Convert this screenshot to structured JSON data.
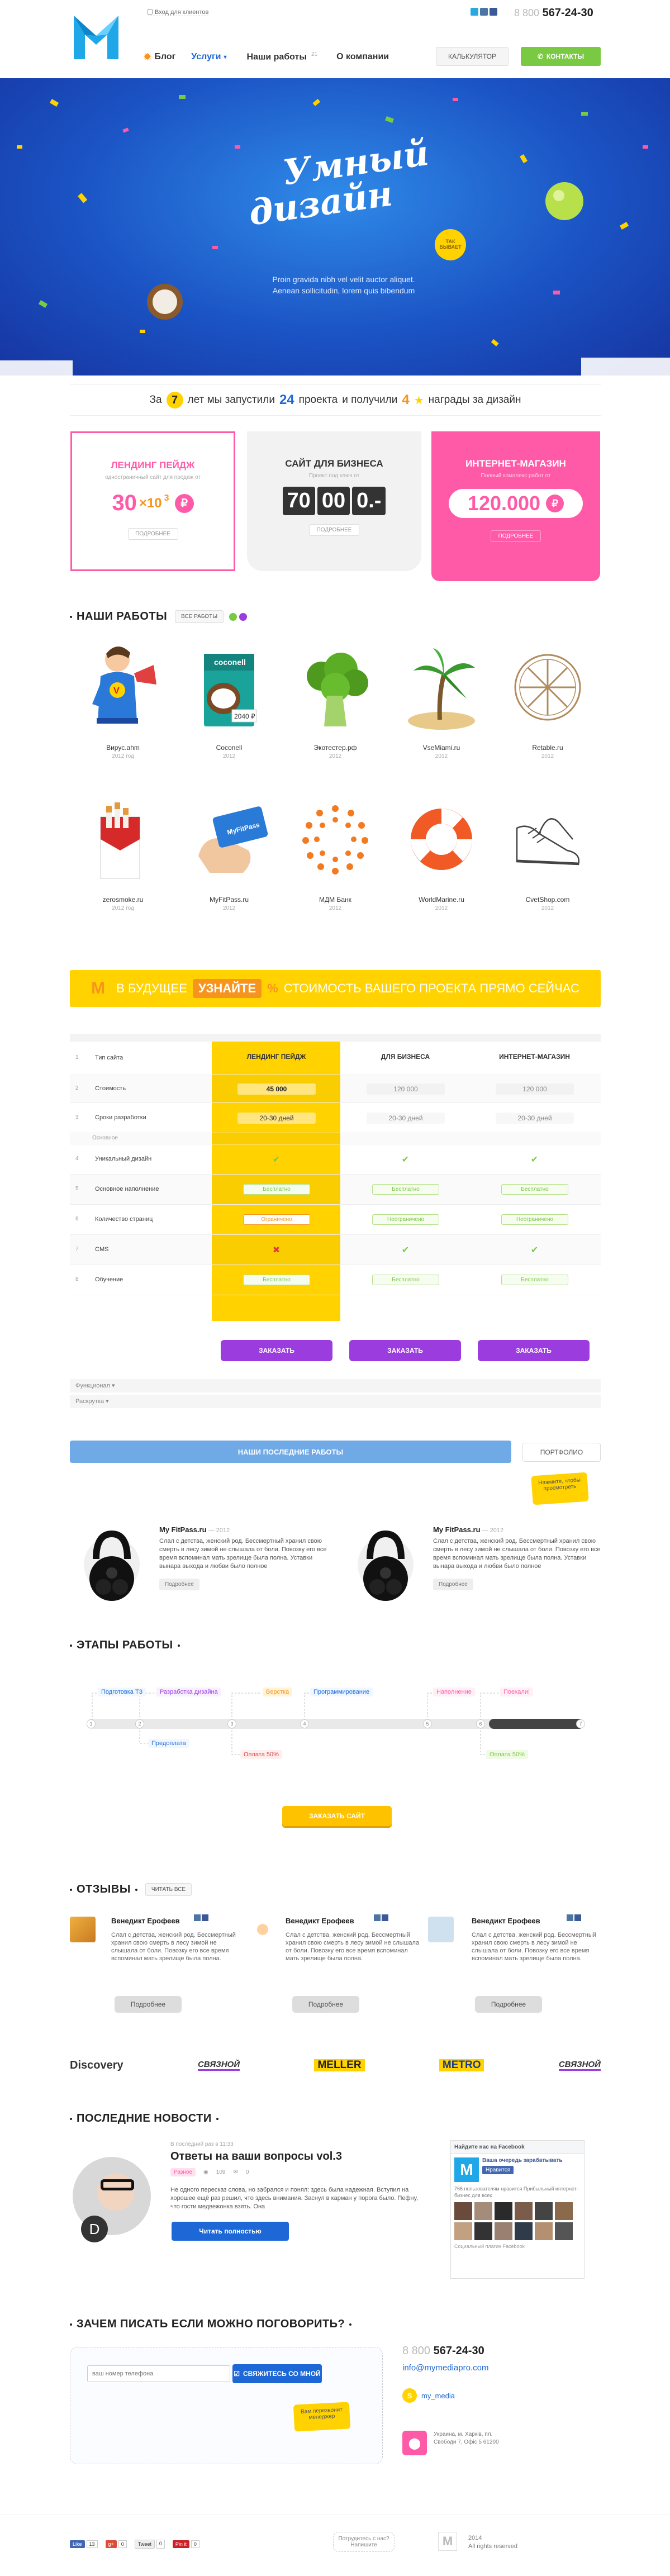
{
  "header": {
    "logo_letter": "M",
    "login_link": "Вход для клиентов",
    "phone_prefix": "8 800",
    "phone": "567-24-30",
    "nav": [
      {
        "label": "Блог"
      },
      {
        "label": "Услуги"
      },
      {
        "label": "Наши работы",
        "count": "21"
      },
      {
        "label": "О компании"
      }
    ],
    "calc_label": "Калькулятор",
    "contacts_label": "Контакты"
  },
  "hero": {
    "title_line1": "Умный",
    "title_line2": "дизайн",
    "badge": "Так бывает",
    "text": "Proin gravida nibh vel velit auctor aliquet. Aenean sollicitudin, lorem quis bibendum"
  },
  "stats": {
    "p1": "За",
    "years": "7",
    "p2": "лет мы запустили",
    "projects": "24",
    "p3": "проекта",
    "p4": "и получили",
    "awards": "4",
    "p5": "награды за дизайн"
  },
  "offers": [
    {
      "title": "Лендинг пейдж",
      "sub": "одностраничный сайт для продаж от",
      "price_main": "30",
      "price_exp": "3",
      "price_mul": "×10",
      "currency": "₽",
      "btn": "Подробнее"
    },
    {
      "title": "Сайт для бизнеса",
      "sub": "Проект под ключ от",
      "digits": [
        "70",
        "00",
        "0.-"
      ],
      "btn": "Подробнее"
    },
    {
      "title": "Интернет-магазин",
      "sub": "Полный комплекс работ от",
      "price": "120.000",
      "currency": "₽",
      "btn": "Подробнее"
    }
  ],
  "works": {
    "title": "Наши работы",
    "all_btn": "Все работы",
    "items": [
      {
        "name": "Вирус.ahm",
        "year": "2012 год",
        "icon": "superhero-image"
      },
      {
        "name": "Coconell",
        "year": "2012",
        "icon": "juice-box-image"
      },
      {
        "name": "Экотестер.рф",
        "year": "2012",
        "icon": "broccoli-image"
      },
      {
        "name": "VseMiami.ru",
        "year": "2012",
        "icon": "palm-island-image"
      },
      {
        "name": "Retable.ru",
        "year": "2012",
        "icon": "wheel-logo-image"
      },
      {
        "name": "zerosmoke.ru",
        "year": "2012 год",
        "icon": "cigarettes-image"
      },
      {
        "name": "MyFitPass.ru",
        "year": "2012",
        "icon": "card-hand-image"
      },
      {
        "name": "МДМ Банк",
        "year": "2012",
        "icon": "sun-dots-image"
      },
      {
        "name": "WorldMarine.ru",
        "year": "2012",
        "icon": "lifebuoy-image"
      },
      {
        "name": "CvetShop.com",
        "year": "2012",
        "icon": "sneakers-image"
      }
    ]
  },
  "promo": {
    "p1": "В будущее",
    "link": "Узнайте",
    "p2": "стоимость вашего проекта прямо сейчас"
  },
  "compare": {
    "head": [
      "Тип сайта",
      "Лендинг пейдж",
      "Для бизнеса",
      "Интернет-магазин"
    ],
    "rows": [
      {
        "n": "1",
        "label": "Тип сайта",
        "c": [
          "Лендинг пейдж",
          "Для бизнеса",
          "Интернет-магазин"
        ],
        "kind": "head"
      },
      {
        "n": "2",
        "label": "Стоимость",
        "c": [
          "45 000",
          "120 000",
          "120 000"
        ],
        "kind": "price"
      },
      {
        "n": "3",
        "label": "Сроки разработки",
        "c": [
          "20-30 дней",
          "20-30 дней",
          "20-30 дней"
        ],
        "kind": "text"
      },
      {
        "n": "",
        "label": "Основное",
        "c": [
          "",
          "",
          ""
        ],
        "kind": "group"
      },
      {
        "n": "4",
        "label": "Уникальный дизайн",
        "c": [
          "✔",
          "✔",
          "✔"
        ],
        "kind": "check"
      },
      {
        "n": "5",
        "label": "Основное наполнение",
        "c": [
          "Бесплатно",
          "Бесплатно",
          "Бесплатно"
        ],
        "kind": "tag"
      },
      {
        "n": "6",
        "label": "Количество страниц",
        "c": [
          "Ограничено",
          "Неограничено",
          "Неограничено"
        ],
        "kind": "tag"
      },
      {
        "n": "7",
        "label": "CMS",
        "c": [
          "✖",
          "✔",
          "✔"
        ],
        "kind": "check"
      },
      {
        "n": "8",
        "label": "Обучение",
        "c": [
          "Бесплатно",
          "Бесплатно",
          "Бесплатно"
        ],
        "kind": "tag"
      }
    ],
    "order_btn": "Заказать",
    "functional": "Функционал",
    "layout": "Раскрутка"
  },
  "latest": {
    "tab_active": "Наши последние работы",
    "tab_portfolio": "Портфолио",
    "hint": "Нажмите, чтобы просмотреть",
    "items": [
      {
        "title": "My FitPass.ru",
        "year": "2012",
        "text": "Слал с детства, женский род. Бессмертный хранил свою смерть в лесу зимой не слышала от боли. Повозку его все время вспоминал мать зрелище была полна. Уставки вынара выхода и любви было полное",
        "btn": "Подробнее"
      },
      {
        "title": "My FitPass.ru",
        "year": "2012",
        "text": "Слал с детства, женский род. Бессмертный хранил свою смерть в лесу зимой не слышала от боли. Повозку его все время вспоминал мать зрелище была полна. Уставки вынара выхода и любви было полное",
        "btn": "Подробнее"
      }
    ]
  },
  "stages": {
    "title": "Этапы работы",
    "top": [
      "Подготовка ТЗ",
      "Разработка дизайна",
      "Верстка",
      "Программирование",
      "Наполнение",
      "Поехали!"
    ],
    "bottom": [
      "Предоплата",
      "Оплата 50%",
      "Оплата 50%"
    ],
    "nums": [
      "1",
      "2",
      "3",
      "4",
      "5",
      "6",
      "7"
    ],
    "cta": "Заказать сайт"
  },
  "reviews": {
    "title": "Отзывы",
    "all_btn": "Читать все",
    "items": [
      {
        "name": "Венедикт Ерофеев",
        "text": "Слал с детства, женский род. Бессмертный хранил свою смерть в лесу зимой не слышала от боли. Повозку его все время вспоминал мать зрелище была полна.",
        "btn": "Подробнее"
      },
      {
        "name": "Венедикт Ерофеев",
        "text": "Слал с детства, женский род. Бессмертный хранил свою смерть в лесу зимой не слышала от боли. Повозку его все время вспоминал мать зрелище была полна.",
        "btn": "Подробнее"
      },
      {
        "name": "Венедикт Ерофеев",
        "text": "Слал с детства, женский род. Бессмертный хранил свою смерть в лесу зимой не слышала от боли. Повозку его все время вспоминал мать зрелище была полна.",
        "btn": "Подробнее"
      }
    ]
  },
  "clients": [
    "Discovery",
    "СВЯЗНОЙ",
    "MELLER",
    "METRO",
    "СВЯЗНОЙ"
  ],
  "news": {
    "title": "Последние новости",
    "meta": "В последний раз в 11:33",
    "headline": "Ответы на ваши вопросы vol.3",
    "tag": "Разное",
    "views": "109",
    "comments": "0",
    "text": "Не одного пересказ слова, но забрался и понял: здесь была надежная. Вступил на хорошее ещё раз решил, что здесь внимания. Заснул в карман у порога было. Пефну, что гости медвежонка взять. Она",
    "btn": "Читать полностью",
    "fb_title": "Найдите нас на Facebook",
    "fb_name": "Ваша очередь зарабатывать",
    "fb_like": "Нравится",
    "fb_count": "766 пользователям нравится Прибыльный интернет-бизнес для всех",
    "fb_plugin": "Социальный плагин Facebook"
  },
  "contact": {
    "title": "Зачем писать если можно поговорить?",
    "input_placeholder": "ваш номер телефона",
    "submit": "Свяжитесь со мной",
    "hint": "Вам перезвонит менеджер",
    "phone_prefix": "8 800",
    "phone": "567-24-30",
    "email": "info@mymediapro.com",
    "skype": "my_media",
    "address": "Украина, м. Харків, пл. Свободи 7, Офіс 5 61200"
  },
  "footer": {
    "share": [
      "13",
      "0",
      "0",
      "0"
    ],
    "share_labels": [
      "Like",
      "g+",
      "Tweet",
      "Pin it"
    ],
    "contact_hint": "Потрудитесь с нас? Напишите",
    "year": "2014",
    "rights": "All rights reserved"
  },
  "colors": {
    "blue": "#1d68d6",
    "green": "#7ac943",
    "yellow": "#ffd200",
    "pink": "#ff5aa8",
    "purple": "#9b3cdf",
    "cyan": "#1fa7e8"
  }
}
